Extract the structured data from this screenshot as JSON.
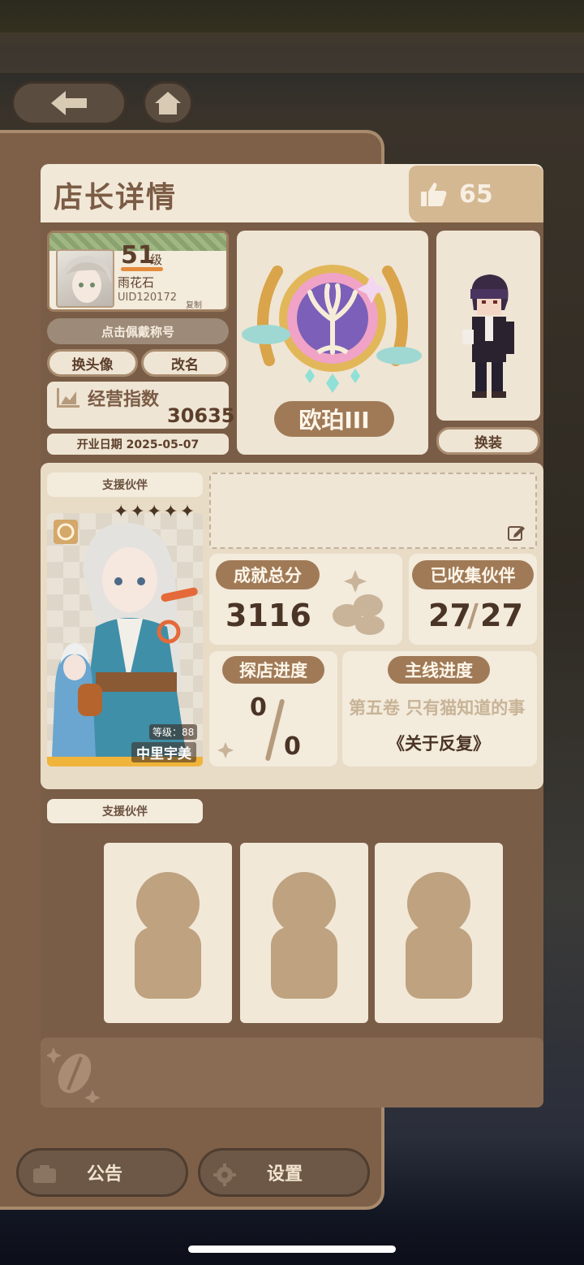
{
  "header": {
    "title": "店长详情",
    "likes": "65"
  },
  "profile": {
    "level": "51",
    "level_unit": "级",
    "name": "雨花石",
    "uid": "UID120172",
    "copy_label": "复制",
    "title_prompt": "点击佩戴称号",
    "change_avatar_label": "换头像",
    "rename_label": "改名",
    "business_index_label": "经营指数",
    "business_index_value": "30635",
    "open_date_label": "开业日期 2025-05-07"
  },
  "rank": {
    "name": "欧珀III"
  },
  "character": {
    "change_outfit_label": "换装"
  },
  "support": {
    "label": "支援伙伴",
    "partner_name": "中里宇美",
    "partner_level": "等级：88",
    "stars": "✦✦✦✦✦"
  },
  "stats": {
    "achievement_label": "成就总分",
    "achievement_value": "3116",
    "collected_label": "已收集伙伴",
    "collected_value": "27",
    "collected_total": "27",
    "explore_label": "探店进度",
    "explore_value": "0",
    "explore_total": "0",
    "story_label": "主线进度",
    "story_chapter": "第五卷 只有猫知道的事",
    "story_title": "《关于反复》"
  },
  "support_slots": {
    "label": "支援伙伴",
    "count_slots": 3
  },
  "bottom": {
    "notice_label": "公告",
    "settings_label": "设置"
  },
  "colors": {
    "panel": "#7a5d46",
    "cream": "#efe5d4",
    "accent": "#a07a57",
    "text_dark": "#4a3426"
  },
  "icons": [
    "back-arrow-icon",
    "home-icon",
    "thumbs-up-icon",
    "chart-icon",
    "edit-icon",
    "coffee-bean-icon",
    "notice-icon",
    "gear-icon",
    "sparkle-icon"
  ]
}
